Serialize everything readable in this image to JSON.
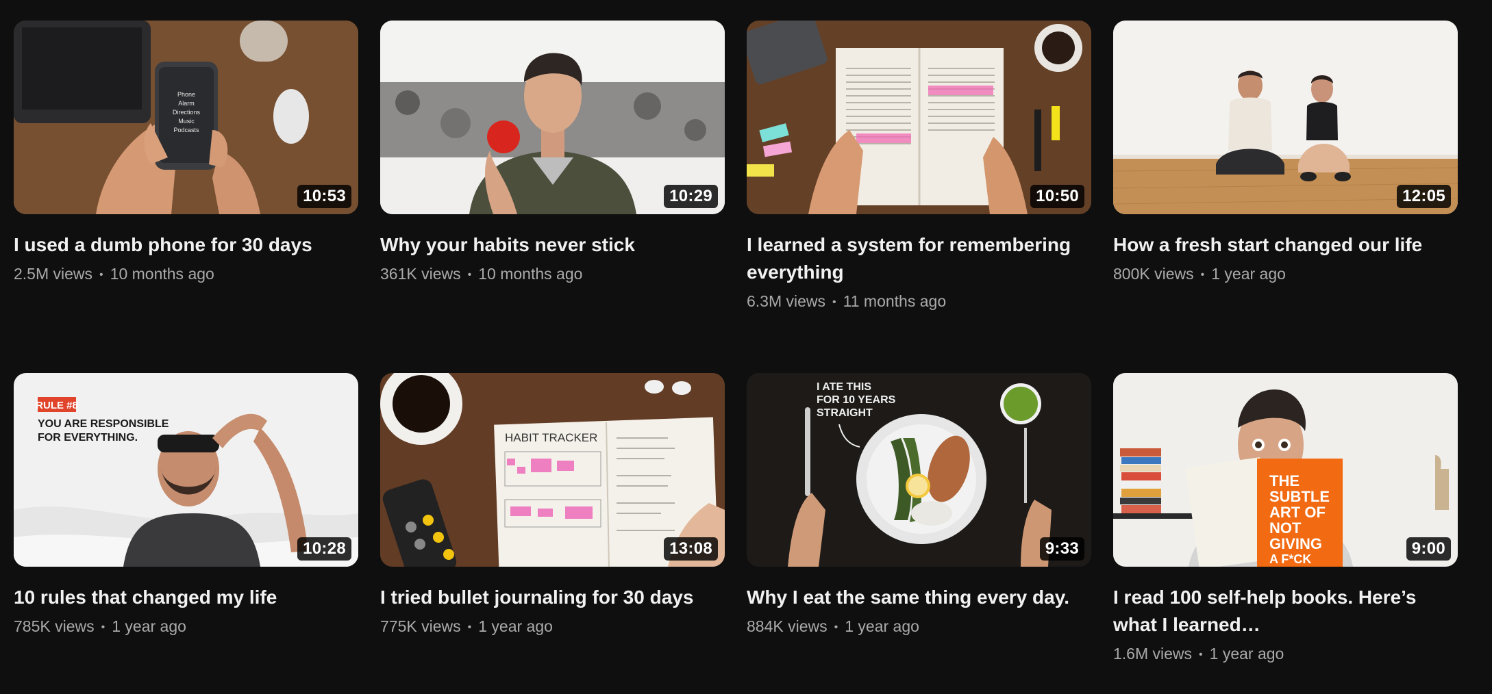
{
  "videos": [
    {
      "title": "I used a dumb phone for 30 days",
      "views": "2.5M views",
      "age": "10 months ago",
      "duration": "10:53",
      "thumbnail_text": [
        "Phone",
        "Alarm",
        "Directions",
        "Music",
        "Podcasts"
      ]
    },
    {
      "title": "Why your habits never stick",
      "views": "361K views",
      "age": "10 months ago",
      "duration": "10:29"
    },
    {
      "title": "I learned a system for remembering everything",
      "views": "6.3M views",
      "age": "11 months ago",
      "duration": "10:50"
    },
    {
      "title": "How a fresh start changed our life",
      "views": "800K views",
      "age": "1 year ago",
      "duration": "12:05"
    },
    {
      "title": "10 rules that changed my life",
      "views": "785K views",
      "age": "1 year ago",
      "duration": "10:28",
      "thumbnail_text": [
        "RULE #8",
        "YOU ARE RESPONSIBLE",
        "FOR EVERYTHING."
      ]
    },
    {
      "title": "I tried bullet journaling for 30 days",
      "views": "775K views",
      "age": "1 year ago",
      "duration": "13:08",
      "thumbnail_text": [
        "HABIT TRACKER"
      ]
    },
    {
      "title": "Why I eat the same thing every day.",
      "views": "884K views",
      "age": "1 year ago",
      "duration": "9:33",
      "thumbnail_text": [
        "I ATE THIS",
        "FOR 10 YEARS",
        "STRAIGHT"
      ]
    },
    {
      "title": "I read 100 self-help books. Here’s what I learned…",
      "views": "1.6M views",
      "age": "1 year ago",
      "duration": "9:00",
      "thumbnail_text": [
        "THE",
        "SUBTLE",
        "ART OF",
        "NOT",
        "GIVING",
        "A F*CK"
      ]
    }
  ]
}
